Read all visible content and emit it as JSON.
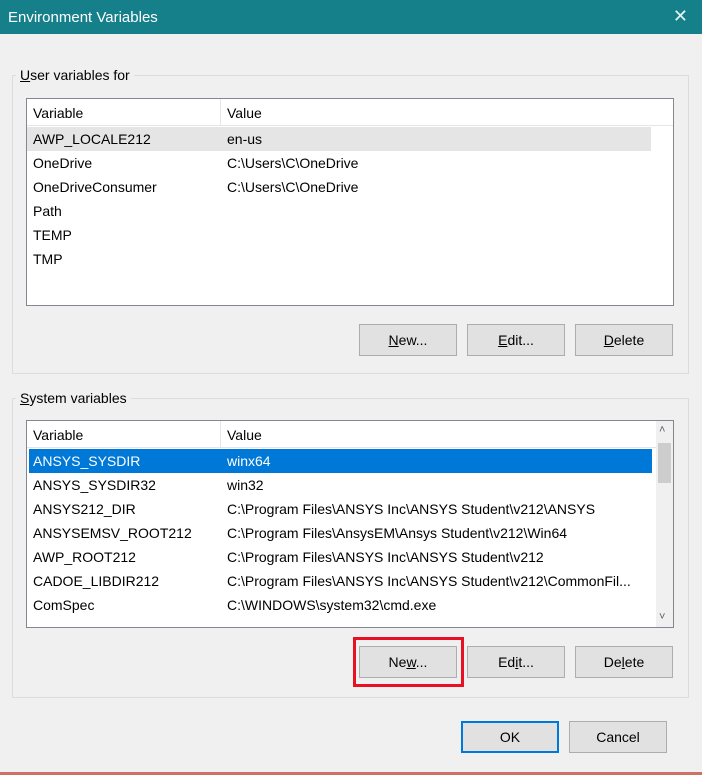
{
  "window": {
    "title": "Environment Variables",
    "close_glyph": "✕"
  },
  "user_section": {
    "label": "User variables for ",
    "label_underline": "U",
    "label_rest": "ser variables for ",
    "columns": [
      "Variable",
      "Value"
    ],
    "rows": [
      {
        "variable": "AWP_LOCALE212",
        "value": "en-us"
      },
      {
        "variable": "OneDrive",
        "value": "C:\\Users\\C\\OneDrive"
      },
      {
        "variable": "OneDriveConsumer",
        "value": "C:\\Users\\C\\OneDrive"
      },
      {
        "variable": "Path",
        "value": ""
      },
      {
        "variable": "TEMP",
        "value": ""
      },
      {
        "variable": "TMP",
        "value": ""
      }
    ],
    "buttons": {
      "new": {
        "u": "N",
        "rest": "ew..."
      },
      "edit": {
        "u": "E",
        "rest": "dit..."
      },
      "delete": {
        "u": "D",
        "rest": "elete"
      }
    }
  },
  "system_section": {
    "label_underline": "S",
    "label_rest": "ystem variables",
    "columns": [
      "Variable",
      "Value"
    ],
    "rows": [
      {
        "variable": "ANSYS_SYSDIR",
        "value": "winx64"
      },
      {
        "variable": "ANSYS_SYSDIR32",
        "value": "win32"
      },
      {
        "variable": "ANSYS212_DIR",
        "value": "C:\\Program Files\\ANSYS Inc\\ANSYS Student\\v212\\ANSYS"
      },
      {
        "variable": "ANSYSEMSV_ROOT212",
        "value": "C:\\Program Files\\AnsysEM\\Ansys Student\\v212\\Win64"
      },
      {
        "variable": "AWP_ROOT212",
        "value": "C:\\Program Files\\ANSYS Inc\\ANSYS Student\\v212"
      },
      {
        "variable": "CADOE_LIBDIR212",
        "value": "C:\\Program Files\\ANSYS Inc\\ANSYS Student\\v212\\CommonFil..."
      },
      {
        "variable": "ComSpec",
        "value": "C:\\WINDOWS\\system32\\cmd.exe"
      }
    ],
    "buttons": {
      "new": {
        "u": "w",
        "pre": "Ne",
        "rest": "..."
      },
      "edit": {
        "u": "i",
        "pre": "Ed",
        "rest": "t..."
      },
      "delete": {
        "u": "l",
        "pre": "De",
        "rest": "ete"
      }
    },
    "scroll_up_glyph": "˄",
    "scroll_down_glyph": "˅"
  },
  "footer": {
    "ok": "OK",
    "cancel": "Cancel"
  },
  "colors": {
    "titlebar": "#15808a",
    "selection": "#0078d7",
    "highlight": "#e81123"
  }
}
